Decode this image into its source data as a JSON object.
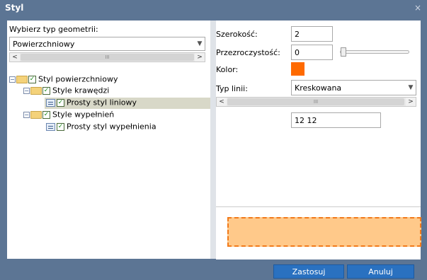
{
  "dialog": {
    "title": "Styl",
    "close_glyph": "×"
  },
  "left": {
    "geometry_label": "Wybierz typ geometrii:",
    "geometry_value": "Powierzchniowy",
    "scroll_thumb_glyph": "III",
    "tree": [
      {
        "label": "Styl powierzchniowy",
        "icon": "folder-icon",
        "checked": true,
        "selected": false
      },
      {
        "label": "Style krawędzi",
        "icon": "folder-icon",
        "checked": true,
        "selected": false
      },
      {
        "label": "Prosty styl liniowy",
        "icon": "style-icon",
        "checked": true,
        "selected": true
      },
      {
        "label": "Style wypełnień",
        "icon": "folder-icon",
        "checked": true,
        "selected": false
      },
      {
        "label": "Prosty styl wypełnienia",
        "icon": "style-icon",
        "checked": true,
        "selected": false
      }
    ]
  },
  "right": {
    "width_label": "Szerokość:",
    "width_value": "2",
    "opacity_label": "Przezroczystość:",
    "opacity_value": "0",
    "opacity_slider_level": 0,
    "color_label": "Kolor:",
    "color_value": "#ff6a00",
    "line_type_label": "Typ linii:",
    "line_type_value": "Kreskowana",
    "scroll_thumb_glyph": "III",
    "dash_pattern_value": "12 12"
  },
  "preview": {
    "fill_color": "#ffc98a",
    "stroke_color": "#f27a1a"
  },
  "footer": {
    "apply_label": "Zastosuj",
    "cancel_label": "Anuluj"
  },
  "colors": {
    "titlebar": "#5c7594",
    "button": "#2a71c0",
    "selected_row": "#d8d8c8"
  }
}
